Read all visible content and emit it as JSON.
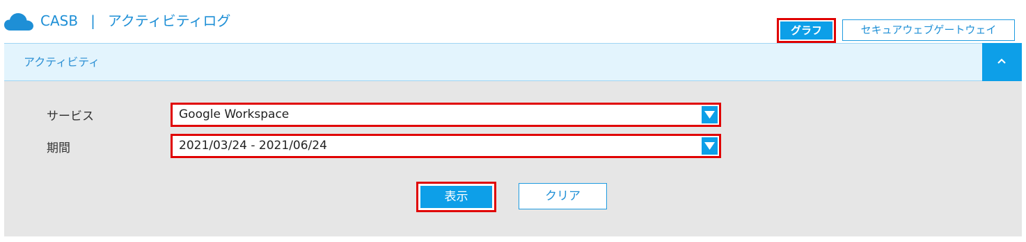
{
  "header": {
    "app_name": "CASB",
    "separator": "|",
    "page_title": "アクティビティログ",
    "icon": "cloud-icon",
    "graph_button": "グラフ",
    "swg_button": "セキュアウェブゲートウェイ"
  },
  "panel": {
    "title": "アクティビティ",
    "collapse_icon": "chevron-up-icon"
  },
  "form": {
    "service_label": "サービス",
    "service_value": "Google Workspace",
    "period_label": "期間",
    "period_value": "2021/03/24 - 2021/06/24",
    "show_button": "表示",
    "clear_button": "クリア"
  },
  "colors": {
    "accent": "#0d9fe8",
    "title_blue": "#1e8fd6",
    "highlight_red": "#e00000",
    "panel_bg": "#e6e6e6",
    "panel_header_bg": "#e3f4fd"
  }
}
